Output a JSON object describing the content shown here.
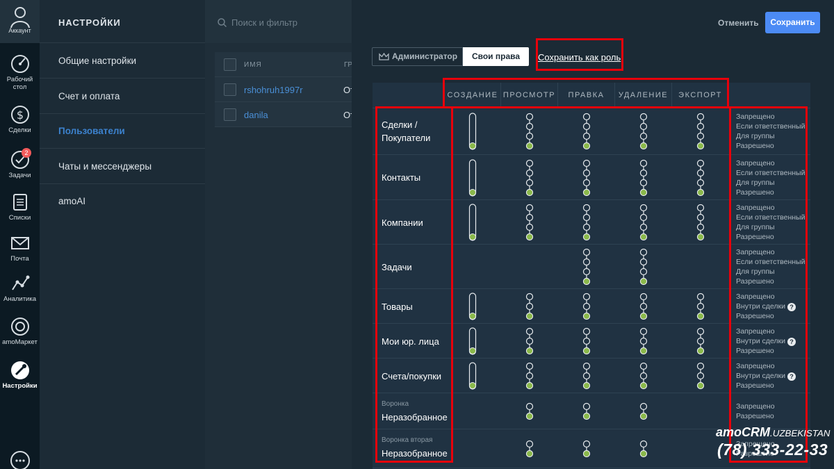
{
  "sidebar": {
    "account": "Аккаунт",
    "items": [
      {
        "label": "Рабочий\nстол",
        "icon": "dashboard-icon"
      },
      {
        "label": "Сделки",
        "icon": "deals-icon"
      },
      {
        "label": "Задачи",
        "icon": "tasks-icon",
        "badge": "2"
      },
      {
        "label": "Списки",
        "icon": "lists-icon"
      },
      {
        "label": "Почта",
        "icon": "mail-icon"
      },
      {
        "label": "Аналитика",
        "icon": "analytics-icon"
      },
      {
        "label": "amoМаркет",
        "icon": "market-icon"
      },
      {
        "label": "Настройки",
        "icon": "settings-icon"
      }
    ]
  },
  "menu": {
    "title": "НАСТРОЙКИ",
    "items": [
      {
        "label": "Общие настройки"
      },
      {
        "label": "Счет и оплата"
      },
      {
        "label": "Пользователи"
      },
      {
        "label": "Чаты и мессенджеры"
      },
      {
        "label": "amoAI"
      }
    ]
  },
  "list": {
    "search_placeholder": "Поиск и фильтр",
    "header_name": "ИМЯ",
    "header_group": "ГР",
    "users": [
      {
        "name": "rshohruh1997r",
        "group": "От"
      },
      {
        "name": "danila",
        "group": "От"
      }
    ]
  },
  "topbar": {
    "cancel": "Отменить",
    "save": "Сохранить"
  },
  "tabs": {
    "admin": "Администратор",
    "own": "Свои права",
    "save_role": "Сохранить как роль"
  },
  "permissions": {
    "columns": [
      "СОЗДАНИЕ",
      "ПРОСМОТР",
      "ПРАВКА",
      "УДАЛЕНИЕ",
      "ЭКСПОРТ"
    ],
    "rows": [
      {
        "label": "Сделки /\nПокупатели",
        "sub": "",
        "options": [
          "Запрещено",
          "Если ответственный",
          "Для группы",
          "Разрешено"
        ],
        "sliders": [
          4,
          4,
          4,
          4,
          4
        ],
        "types": [
          "bar",
          "dots",
          "dots",
          "dots",
          "dots"
        ]
      },
      {
        "label": "Контакты",
        "sub": "",
        "options": [
          "Запрещено",
          "Если ответственный",
          "Для группы",
          "Разрешено"
        ],
        "sliders": [
          4,
          4,
          4,
          4,
          4
        ],
        "types": [
          "bar",
          "dots",
          "dots",
          "dots",
          "dots"
        ]
      },
      {
        "label": "Компании",
        "sub": "",
        "options": [
          "Запрещено",
          "Если ответственный",
          "Для группы",
          "Разрешено"
        ],
        "sliders": [
          4,
          4,
          4,
          4,
          4
        ],
        "types": [
          "bar",
          "dots",
          "dots",
          "dots",
          "dots"
        ]
      },
      {
        "label": "Задачи",
        "sub": "",
        "options": [
          "Запрещено",
          "Если ответственный",
          "Для группы",
          "Разрешено"
        ],
        "sliders": [
          0,
          0,
          4,
          4,
          0
        ],
        "types": [
          "none",
          "none",
          "dots",
          "dots",
          "none"
        ]
      },
      {
        "label": "Товары",
        "sub": "",
        "options": [
          "Запрещено",
          "Внутри сделки",
          "Разрешено"
        ],
        "help": 1,
        "sliders": [
          3,
          3,
          3,
          3,
          3
        ],
        "types": [
          "bar",
          "dots",
          "dots",
          "dots",
          "dots"
        ]
      },
      {
        "label": "Мои юр. лица",
        "sub": "",
        "options": [
          "Запрещено",
          "Внутри сделки",
          "Разрешено"
        ],
        "help": 1,
        "sliders": [
          3,
          3,
          3,
          3,
          3
        ],
        "types": [
          "bar",
          "dots",
          "dots",
          "dots",
          "dots"
        ]
      },
      {
        "label": "Счета/покупки",
        "sub": "",
        "options": [
          "Запрещено",
          "Внутри сделки",
          "Разрешено"
        ],
        "help": 1,
        "sliders": [
          3,
          3,
          3,
          3,
          3
        ],
        "types": [
          "bar",
          "dots",
          "dots",
          "dots",
          "dots"
        ]
      },
      {
        "label": "Неразобранное",
        "sub": "Воронка",
        "options": [
          "Запрещено",
          "Разрешено"
        ],
        "sliders": [
          0,
          2,
          2,
          2,
          0
        ],
        "types": [
          "none",
          "dots",
          "dots",
          "dots",
          "none"
        ]
      },
      {
        "label": "Неразобранное",
        "sub": "Воронка вторая",
        "options": [
          "Запрещено",
          "Разрешено"
        ],
        "sliders": [
          0,
          2,
          2,
          2,
          0
        ],
        "types": [
          "none",
          "dots",
          "dots",
          "dots",
          "none"
        ]
      }
    ]
  },
  "watermark": {
    "brand": "amoCRM",
    "country": ".UZBEKISTAN",
    "phone": "(78) 333-22-33"
  },
  "colors": {
    "accent_blue": "#4c8bf5",
    "link_blue": "#4a8fd6",
    "highlight_red": "#e8000b",
    "slider_green": "#8ab84a"
  }
}
